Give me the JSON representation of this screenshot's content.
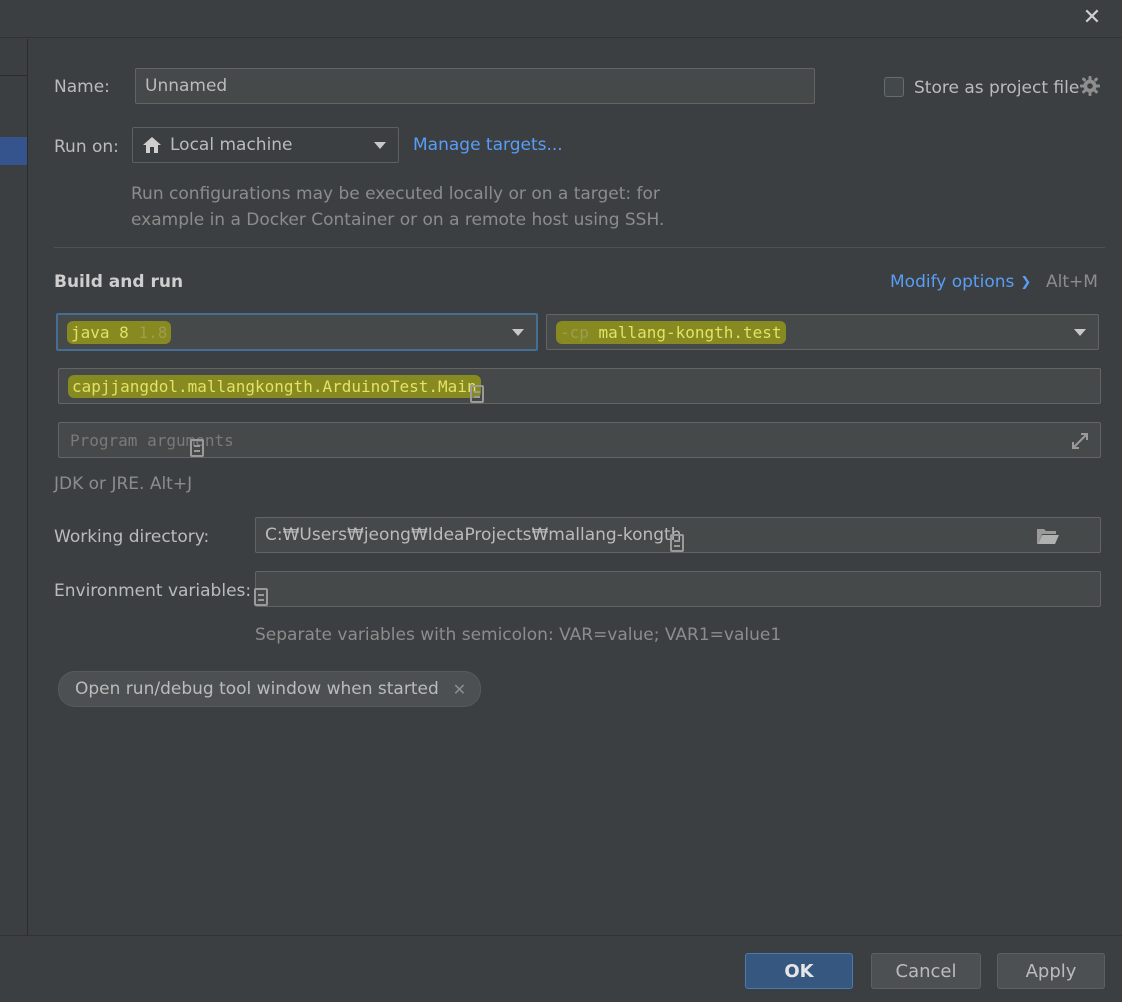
{
  "dialog": {
    "close_icon": "close-icon"
  },
  "name": {
    "label": "Name:",
    "value": "Unnamed"
  },
  "store_as_project_file": {
    "label": "Store as project file",
    "checked": false
  },
  "run_on": {
    "label": "Run on:",
    "target": "Local machine",
    "manage_link": "Manage targets...",
    "hint_line1": "Run configurations may be executed locally or on a target: for",
    "hint_line2": "example in a Docker Container or on a remote host using SSH."
  },
  "build_and_run": {
    "title": "Build and run",
    "modify_options": "Modify options",
    "modify_shortcut": "Alt+M",
    "jdk_name": "java 8",
    "jdk_version": "1.8",
    "classpath_flag": "-cp",
    "classpath_module": "mallang-kongth.test",
    "main_class": "capjjangdol.mallangkongth.ArduinoTest.Main",
    "program_args_placeholder": "Program arguments",
    "jdk_hint": "JDK or JRE. Alt+J"
  },
  "working_directory": {
    "label": "Working directory:",
    "value": "C:₩Users₩jeong₩IdeaProjects₩mallang-kongth"
  },
  "environment_variables": {
    "label": "Environment variables:",
    "value": "",
    "hint": "Separate variables with semicolon: VAR=value; VAR1=value1"
  },
  "options_chip": {
    "label": "Open run/debug tool window when started"
  },
  "buttons": {
    "ok": "OK",
    "cancel": "Cancel",
    "apply": "Apply"
  },
  "colors": {
    "background": "#3c3f41",
    "field_bg": "#45494a",
    "link": "#589df6",
    "primary_button": "#365880",
    "highlight": "#bebe00"
  }
}
